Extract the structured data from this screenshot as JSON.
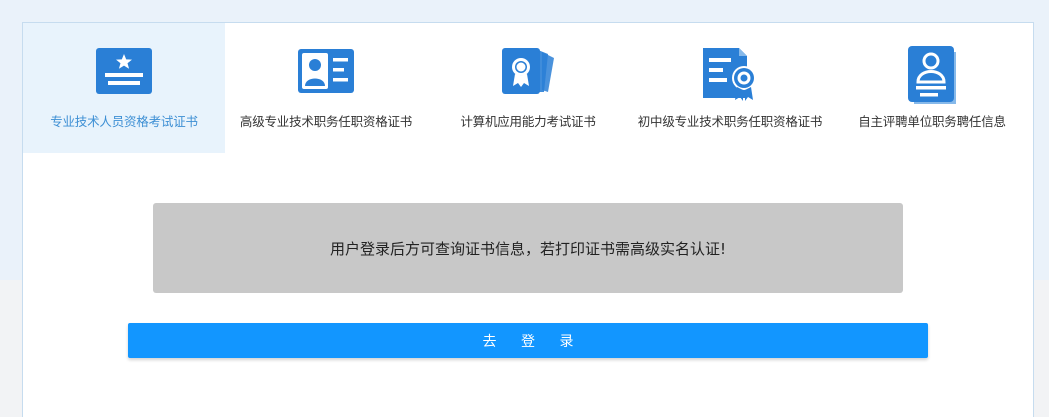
{
  "tabs": [
    {
      "label": "专业技术人员资格考试证书",
      "icon": "certificate-star-icon",
      "active": true
    },
    {
      "label": "高级专业技术职务任职资格证书",
      "icon": "id-card-icon",
      "active": false
    },
    {
      "label": "计算机应用能力考试证书",
      "icon": "certificate-medal-icon",
      "active": false
    },
    {
      "label": "初中级专业技术职务任职资格证书",
      "icon": "document-seal-icon",
      "active": false
    },
    {
      "label": "自主评聘单位职务聘任信息",
      "icon": "person-document-icon",
      "active": false
    }
  ],
  "notice": {
    "text": "用户登录后方可查询证书信息，若打印证书需高级实名认证!"
  },
  "login": {
    "label": "去  登  录"
  },
  "colors": {
    "icon_blue": "#2a7fd6",
    "active_tab_bg": "#e8f3fc",
    "active_label": "#3d8fd4",
    "button_blue": "#1296ff",
    "notice_bg": "#c8c8c8"
  }
}
